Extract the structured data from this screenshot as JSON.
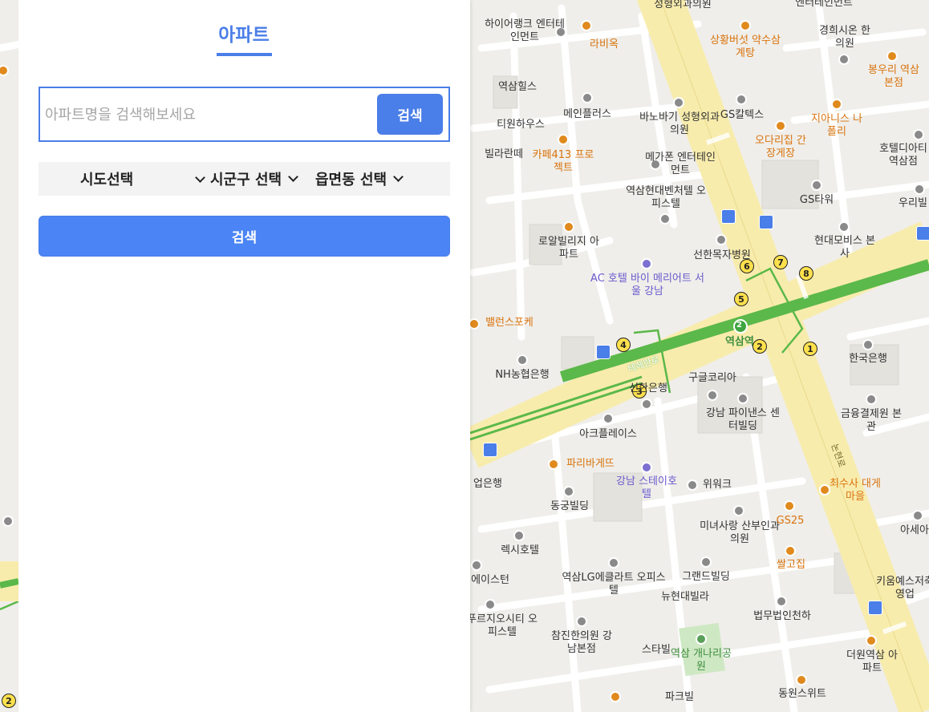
{
  "panel": {
    "tab_title": "아파트",
    "search": {
      "placeholder": "아파트명을 검색해보세요",
      "button_label": "검색"
    },
    "filters": {
      "sido": "시도선택",
      "sigungu": "시군구 선택",
      "eupmyeondong": "읍면동 선택"
    },
    "search_button_label": "검색"
  },
  "map": {
    "station_label": "역삼역",
    "road_labels": [
      "테헤란로",
      "논현로"
    ],
    "subway_line_number": "2",
    "exit_numbers": [
      "1",
      "2",
      "3",
      "4",
      "5",
      "6",
      "7",
      "8"
    ],
    "pois": [
      "성형외과의원",
      "엔터테인먼트",
      "하이어랭크 엔터테인먼트",
      "라비옥",
      "상황버섯 약수삼계탕",
      "경희시온 한의원",
      "봉우리 역삼본점",
      "역삼힐스",
      "메인플러스",
      "바노바기 성형외과의원",
      "GS칼텍스",
      "지아니스 나폴리",
      "티원하우스",
      "오다리집 간장게장",
      "빌라란떼",
      "카페413 프로젝트",
      "메가폰 엔터테인먼트",
      "호텔디아티 역삼점",
      "역삼현대벤처텔 오피스텔",
      "GS타워",
      "우리빌",
      "로알빌리지 아파트",
      "현대모비스 본사",
      "선한목자병원",
      "AC 호텔 바이 메리어트 서울 강남",
      "밸런스포케",
      "NH농협은행",
      "한국은행",
      "구글코리아",
      "신한은행",
      "강남 파이낸스 센터빌딩",
      "금융결제원 본관",
      "아크플레이스",
      "파리바게뜨",
      "강남 스테이호텔",
      "위워크",
      "최수사 대게마을",
      "동궁빌딩",
      "미녀사랑 산부인과의원",
      "GS25",
      "아세아",
      "렉시호텔",
      "쌀고집",
      "역삼LG에클라트 오피스텔",
      "그랜드빌딩",
      "뉴현대빌라",
      "키움예스저축 영업",
      "푸르지오시티 오피스텔",
      "법무법인천하",
      "참진한의원 강남본점",
      "스타빌",
      "역삼 개나리공원",
      "더원역삼 아파트",
      "파크빌",
      "동원스위트",
      "에이스턴",
      "업은행"
    ]
  }
}
